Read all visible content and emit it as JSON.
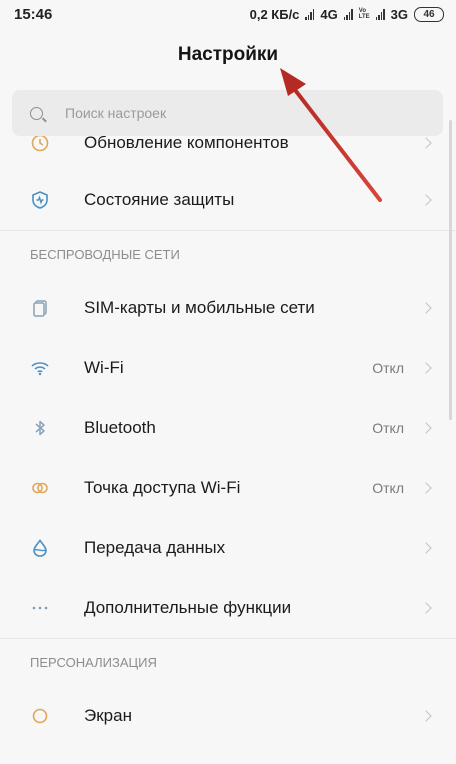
{
  "status_bar": {
    "time": "15:46",
    "net_speed": "0,2 КБ/с",
    "net1": "4G",
    "volte_top": "Vo",
    "volte_bottom": "LTE",
    "net2": "3G",
    "battery": "46"
  },
  "header": {
    "title": "Настройки"
  },
  "search": {
    "placeholder": "Поиск настроек"
  },
  "rows": {
    "updates": {
      "label": "Обновление компонентов",
      "icon": "update-icon"
    },
    "protection": {
      "label": "Состояние защиты",
      "icon": "shield-icon"
    },
    "sim": {
      "label": "SIM-карты и мобильные сети",
      "icon": "sim-card-icon"
    },
    "wifi": {
      "label": "Wi-Fi",
      "value": "Откл",
      "icon": "wifi-icon"
    },
    "bluetooth": {
      "label": "Bluetooth",
      "value": "Откл",
      "icon": "bluetooth-icon"
    },
    "hotspot": {
      "label": "Точка доступа Wi-Fi",
      "value": "Откл",
      "icon": "hotspot-icon"
    },
    "data": {
      "label": "Передача данных",
      "icon": "data-drop-icon"
    },
    "more": {
      "label": "Дополнительные функции",
      "icon": "more-dots-icon"
    },
    "display": {
      "label": "Экран",
      "icon": "display-sun-icon"
    }
  },
  "sections": {
    "wireless": "БЕСПРОВОДНЫЕ СЕТИ",
    "personal": "ПЕРСОНАЛИЗАЦИЯ"
  },
  "colors": {
    "annotation_arrow": "#c0392b",
    "icon_blue": "#4a90c4",
    "icon_orange": "#e2a65a"
  }
}
